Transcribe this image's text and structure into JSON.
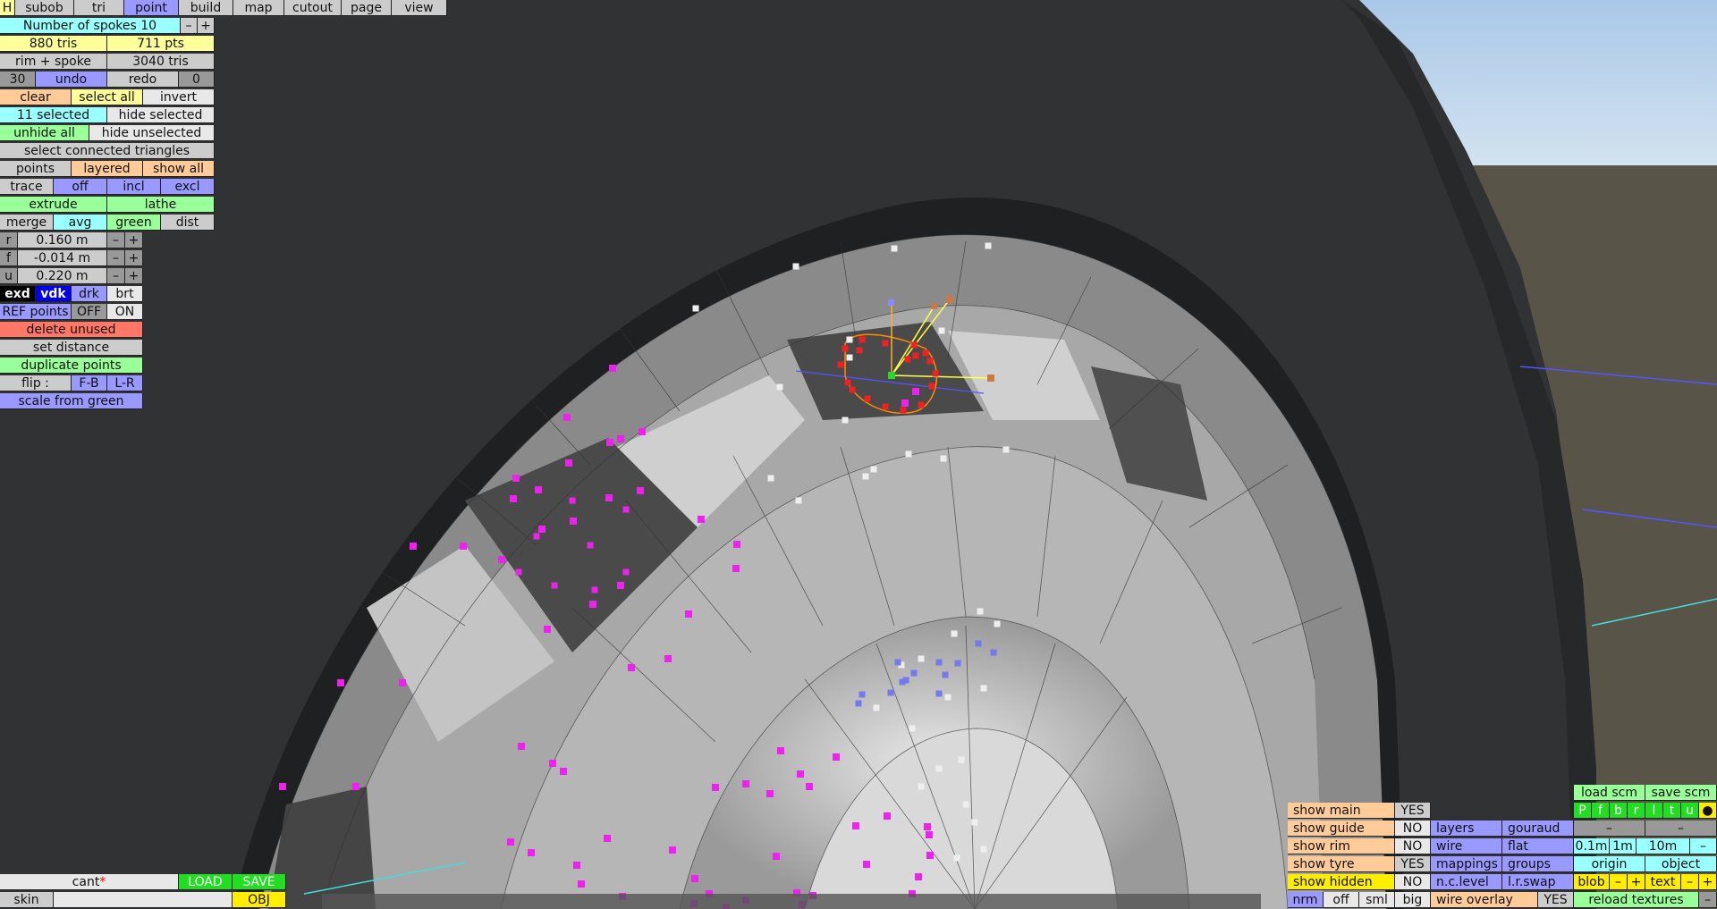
{
  "top_menu": [
    "H",
    "subob",
    "tri",
    "point",
    "build",
    "map",
    "cutout",
    "page",
    "view"
  ],
  "left_panel": {
    "spokes_label": "Number of spokes 10",
    "minus": "–",
    "plus": "+",
    "tris": "880 tris",
    "pts": "711 pts",
    "rim_spoke": "rim + spoke",
    "rim_spoke_tris": "3040 tris",
    "undo_count": "30",
    "undo": "undo",
    "redo": "redo",
    "redo_count": "0",
    "clear": "clear",
    "select_all": "select all",
    "invert": "invert",
    "selected": "11 selected",
    "hide_selected": "hide selected",
    "unhide_all": "unhide all",
    "hide_unselected": "hide unselected",
    "select_connected": "select connected triangles",
    "points": "points",
    "layered": "layered",
    "show_all": "show all",
    "trace": "trace",
    "off": "off",
    "incl": "incl",
    "excl": "excl",
    "extrude": "extrude",
    "lathe": "lathe",
    "merge": "merge",
    "avg": "avg",
    "green": "green",
    "dist": "dist",
    "r_label": "r",
    "r_value": "0.160 m",
    "f_label": "f",
    "f_value": "-0.014 m",
    "u_label": "u",
    "u_value": "0.220 m",
    "exd": "exd",
    "vdk": "vdk",
    "drk": "drk",
    "brt": "brt",
    "ref_points": "REF points",
    "ref_off": "OFF",
    "ref_on": "ON",
    "delete_unused": "delete unused",
    "set_distance": "set distance",
    "duplicate_points": "duplicate points",
    "flip": "flip :",
    "fb": "F-B",
    "lr": "L-R",
    "scale_from_green": "scale from green"
  },
  "bottom_left": {
    "cant": "cant",
    "star": "*",
    "load": "LOAD",
    "save": "SAVE",
    "skin": "skin",
    "obj": "OBJ"
  },
  "bottom_right": {
    "show_main": "show main",
    "show_main_v": "YES",
    "show_guide": "show guide",
    "show_guide_v": "NO",
    "show_rim": "show rim",
    "show_rim_v": "NO",
    "show_tyre": "show tyre",
    "show_tyre_v": "YES",
    "show_hidden": "show hidden",
    "show_hidden_v": "NO",
    "nrm": "nrm",
    "off": "off",
    "sml": "sml",
    "big": "big",
    "layers": "layers",
    "gouraud": "gouraud",
    "wire": "wire",
    "flat": "flat",
    "mappings": "mappings",
    "groups": "groups",
    "nclevel": "n.c.level",
    "lrswap": "l.r.swap",
    "wire_overlay": "wire overlay",
    "wire_overlay_v": "YES",
    "load_scm": "load scm",
    "save_scm": "save scm",
    "views": [
      "P",
      "f",
      "b",
      "r",
      "l",
      "t",
      "u",
      "●"
    ],
    "dash": "–",
    "scale_01": "0.1m",
    "scale_1": "1m",
    "scale_10": "10m",
    "origin": "origin",
    "object": "object",
    "blob": "blob",
    "text": "text",
    "reload_textures": "reload textures"
  }
}
